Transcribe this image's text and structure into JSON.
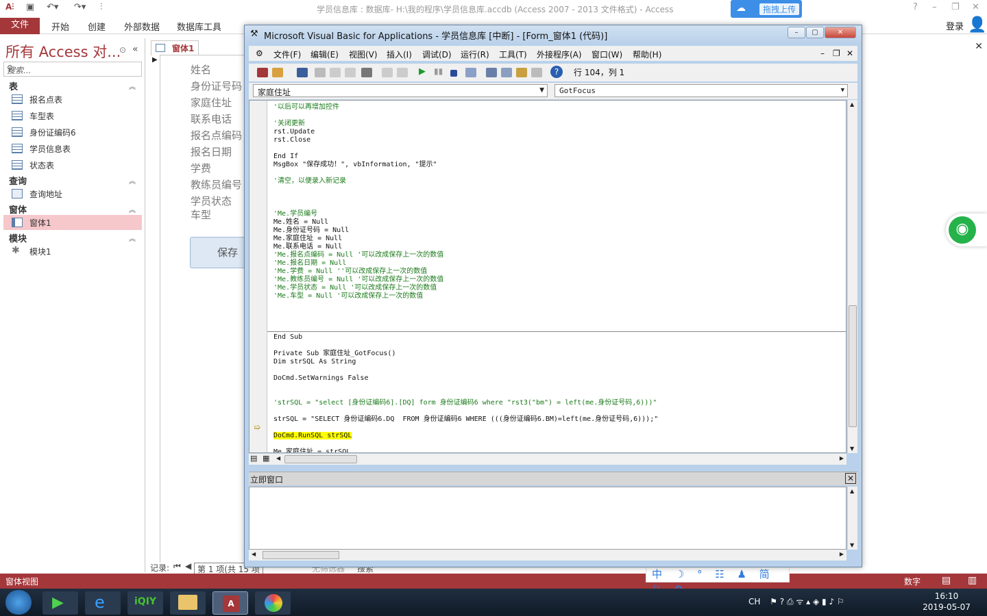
{
  "access": {
    "title": "学员信息库 : 数据库- H:\\我的程序\\学员信息库.accdb (Access 2007 - 2013 文件格式) - Access",
    "ribbon_tabs": [
      "文件",
      "开始",
      "创建",
      "外部数据",
      "数据库工具"
    ],
    "login": "登录",
    "upload": "拖拽上传",
    "help": "?"
  },
  "nav": {
    "title": "所有 Access 对...",
    "search_placeholder": "搜索...",
    "groups": {
      "tables": "表",
      "queries": "查询",
      "forms": "窗体",
      "modules": "模块"
    },
    "tables": [
      "报名点表",
      "车型表",
      "身份证编码6",
      "学员信息表",
      "状态表"
    ],
    "queries": [
      "查询地址"
    ],
    "forms": [
      "窗体1"
    ],
    "modules": [
      "模块1"
    ]
  },
  "form": {
    "tab": "窗体1",
    "labels": [
      "姓名",
      "身份证号码",
      "家庭住址",
      "联系电话",
      "报名点编码",
      "报名日期",
      "学费",
      "教练员编号",
      "学员状态",
      "车型"
    ],
    "save_button": "保存",
    "record_label": "记录:",
    "record_info": "第 1 项(共 15 项",
    "no_filter": "无筛选器",
    "search": "搜索"
  },
  "status": {
    "left": "窗体视图",
    "right": "数字"
  },
  "ime": "中 ☽ ° ☷ ♟ 简 ⚐ ⚙",
  "vba": {
    "title": "Microsoft Visual Basic for Applications - 学员信息库 [中断] - [Form_窗体1 (代码)]",
    "menus": [
      "文件(F)",
      "编辑(E)",
      "视图(V)",
      "插入(I)",
      "调试(D)",
      "运行(R)",
      "工具(T)",
      "外接程序(A)",
      "窗口(W)",
      "帮助(H)"
    ],
    "position": "行 104，列 1",
    "object_combo": "家庭住址",
    "proc_combo": "GotFocus",
    "immediate_title": "立即窗口",
    "code_top": [
      {
        "t": "'以后可以再增加控件",
        "c": true
      },
      {
        "t": "",
        "c": false
      },
      {
        "t": "'关闭更新",
        "c": true
      },
      {
        "t": "rst.Update",
        "c": false
      },
      {
        "t": "rst.Close",
        "c": false
      },
      {
        "t": "",
        "c": false
      },
      {
        "t": "End If",
        "c": false
      },
      {
        "t": "MsgBox \"保存成功！\", vbInformation, \"提示\"",
        "c": false
      },
      {
        "t": "",
        "c": false
      },
      {
        "t": "'清空，以便录入新记录",
        "c": true
      },
      {
        "t": "",
        "c": false
      },
      {
        "t": "",
        "c": false
      },
      {
        "t": "",
        "c": false
      },
      {
        "t": "'Me.学员编号",
        "c": true
      },
      {
        "t": "Me.姓名 = Null",
        "c": false
      },
      {
        "t": "Me.身份证号码 = Null",
        "c": false
      },
      {
        "t": "Me.家庭住址 = Null",
        "c": false
      },
      {
        "t": "Me.联系电话 = Null",
        "c": false
      },
      {
        "t": "'Me.报名点编码 = Null '可以改成保存上一次的数值",
        "c": true
      },
      {
        "t": "'Me.报名日期 = Null",
        "c": true
      },
      {
        "t": "'Me.学费 = Null ''可以改成保存上一次的数值",
        "c": true
      },
      {
        "t": "'Me.教练员编号 = Null '可以改成保存上一次的数值",
        "c": true
      },
      {
        "t": "'Me.学员状态 = Null '可以改成保存上一次的数值",
        "c": true
      },
      {
        "t": "'Me.车型 = Null '可以改成保存上一次的数值",
        "c": true
      },
      {
        "t": "",
        "c": false
      },
      {
        "t": "",
        "c": false
      },
      {
        "t": "",
        "c": false
      },
      {
        "t": "",
        "c": false
      },
      {
        "t": "End Sub",
        "c": false
      }
    ],
    "code_bottom": [
      {
        "t": "Private Sub 家庭住址_GotFocus()",
        "c": false
      },
      {
        "t": "Dim strSQL As String",
        "c": false
      },
      {
        "t": "",
        "c": false
      },
      {
        "t": "DoCmd.SetWarnings False",
        "c": false
      },
      {
        "t": "",
        "c": false
      },
      {
        "t": "",
        "c": false
      },
      {
        "t": "'strSQL = \"select [身份证编码6].[DQ] form 身份证编码6 where \"rst3(\"bm\") = left(me.身份证号码,6)))\"",
        "c": true
      },
      {
        "t": "",
        "c": false
      },
      {
        "t": "strSQL = \"SELECT 身份证编码6.DQ  FROM 身份证编码6 WHERE (((身份证编码6.BM)=left(me.身份证号码,6)));\"",
        "c": false
      },
      {
        "t": "",
        "c": false
      },
      {
        "t": "DoCmd.RunSQL strSQL",
        "c": false,
        "hl": true
      },
      {
        "t": "",
        "c": false
      },
      {
        "t": "Me.家庭住址 = strSQL",
        "c": false
      }
    ]
  },
  "taskbar": {
    "lang": "CH",
    "time": "16:10",
    "date": "2019-05-07"
  },
  "colors": {
    "access_accent": "#a4373a",
    "comment": "#1a7a1a",
    "highlight": "#ffff00",
    "vba_frame": "#b9d1ea"
  }
}
